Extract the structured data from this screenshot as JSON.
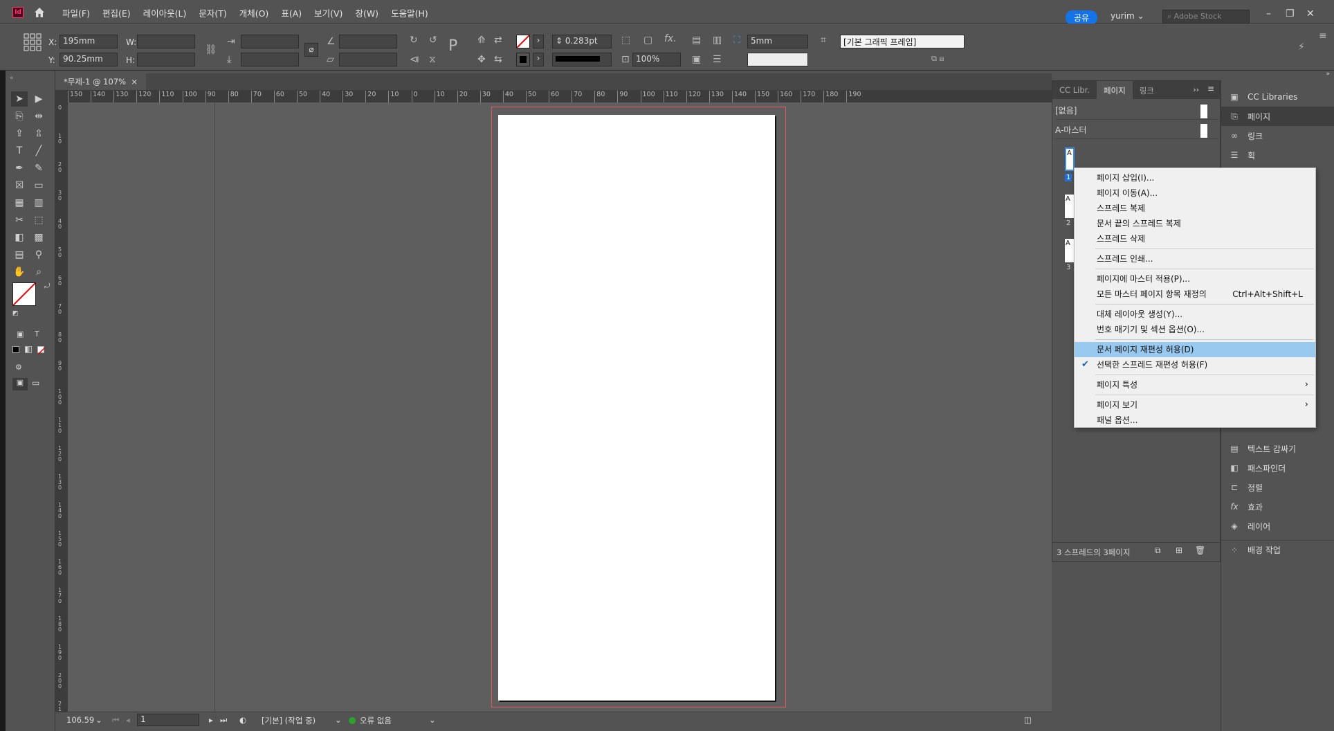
{
  "app": {
    "icon_label": "Id",
    "menu": [
      "파일(F)",
      "편집(E)",
      "레이아웃(L)",
      "문자(T)",
      "개체(O)",
      "표(A)",
      "보기(V)",
      "창(W)",
      "도움말(H)"
    ],
    "share_label": "공유",
    "user_name": "yurim",
    "stock_placeholder": "Adobe Stock"
  },
  "control": {
    "x_label": "X:",
    "x_value": "195mm",
    "y_label": "Y:",
    "y_value": "90.25mm",
    "w_label": "W:",
    "h_label": "H:",
    "stroke_weight": "0.283pt",
    "opacity": "100%",
    "offset": "5mm",
    "frame_style": "[기본 그래픽 프레임]"
  },
  "document": {
    "tab_label": "*무제-1 @ 107%",
    "close_glyph": "×"
  },
  "ruler": {
    "h_ticks": [
      "150",
      "140",
      "130",
      "120",
      "110",
      "100",
      "90",
      "80",
      "70",
      "60",
      "50",
      "40",
      "30",
      "20",
      "10",
      "0",
      "10",
      "20",
      "30",
      "40",
      "50",
      "60",
      "70",
      "80",
      "90",
      "100",
      "110",
      "120",
      "130",
      "140",
      "150",
      "160",
      "170",
      "180",
      "190"
    ],
    "v_ticks": [
      "0",
      "10",
      "20",
      "30",
      "40",
      "50",
      "60",
      "70",
      "80",
      "90",
      "100",
      "110",
      "120",
      "130",
      "140",
      "150",
      "160",
      "170",
      "180",
      "190",
      "200",
      "210"
    ]
  },
  "status": {
    "zoom": "106.59",
    "page_number": "1",
    "profile": "[기본] (작업 중)",
    "errors": "오류 없음"
  },
  "pages_panel": {
    "tabs": [
      "CC Libr.",
      "페이지",
      "링크"
    ],
    "masters": [
      "[없음]",
      "A-마스터"
    ],
    "page_labels": [
      "A",
      "1",
      "A",
      "2",
      "A",
      "3"
    ],
    "footer": "3 스프레드의 3페이지"
  },
  "dock": {
    "top_items": [
      "CC Libraries",
      "페이지",
      "링크",
      "획"
    ],
    "bottom_items": [
      "텍스트 감싸기",
      "패스파인더",
      "정렬",
      "효과",
      "레이어",
      "배경 작업"
    ]
  },
  "context_menu": {
    "items": [
      {
        "label": "페이지 삽입(I)..."
      },
      {
        "label": "페이지 이동(A)..."
      },
      {
        "label": "스프레드 복제"
      },
      {
        "label": "문서 끝의 스프레드 복제"
      },
      {
        "label": "스프레드 삭제"
      },
      {
        "sep": true
      },
      {
        "label": "스프레드 인쇄..."
      },
      {
        "sep": true
      },
      {
        "label": "페이지에 마스터 적용(P)..."
      },
      {
        "label": "모든 마스터 페이지 항목 재정의",
        "shortcut": "Ctrl+Alt+Shift+L"
      },
      {
        "sep": true
      },
      {
        "label": "대체 레이아웃 생성(Y)..."
      },
      {
        "label": "번호 매기기 및 섹션 옵션(O)..."
      },
      {
        "sep": true
      },
      {
        "label": "문서 페이지 재편성 허용(D)",
        "highlighted": true
      },
      {
        "label": "선택한 스프레드 재편성 허용(F)",
        "checked": true
      },
      {
        "sep": true
      },
      {
        "label": "페이지 특성",
        "submenu": true
      },
      {
        "sep": true
      },
      {
        "label": "페이지 보기",
        "submenu": true
      },
      {
        "label": "패널 옵션..."
      }
    ]
  },
  "colors": {
    "accent": "#1473e6",
    "page_border": "#e6575e",
    "menu_highlight": "#99c9ef"
  }
}
